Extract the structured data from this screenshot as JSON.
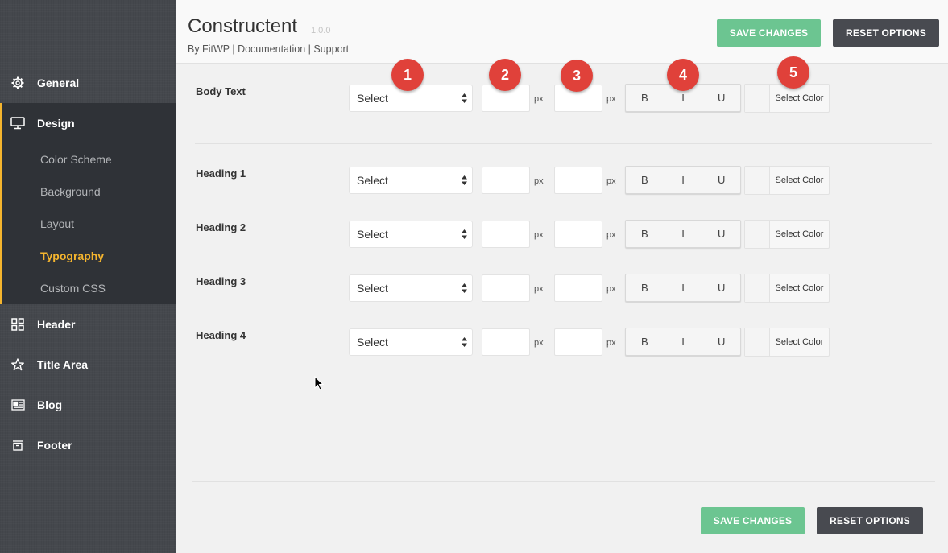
{
  "sidebar": {
    "items": [
      {
        "label": "General",
        "icon": "gear-icon"
      },
      {
        "label": "Design",
        "icon": "monitor-icon"
      },
      {
        "label": "Header",
        "icon": "grid-icon"
      },
      {
        "label": "Title Area",
        "icon": "star-icon"
      },
      {
        "label": "Blog",
        "icon": "newspaper-icon"
      },
      {
        "label": "Footer",
        "icon": "archive-icon"
      }
    ],
    "design_subitems": [
      "Color Scheme",
      "Background",
      "Layout",
      "Typography",
      "Custom CSS"
    ],
    "active_subitem": "Typography"
  },
  "header": {
    "title": "Constructent",
    "version": "1.0.0",
    "by": "By FitWP",
    "sep": "|",
    "documentation": "Documentation",
    "support": "Support",
    "save_label": "SAVE CHANGES",
    "reset_label": "RESET OPTIONS"
  },
  "rows": [
    {
      "label": "Body Text"
    },
    {
      "label": "Heading 1"
    },
    {
      "label": "Heading 2"
    },
    {
      "label": "Heading 3"
    },
    {
      "label": "Heading 4"
    }
  ],
  "controls": {
    "select_value": "Select",
    "unit": "px",
    "bold": "B",
    "italic": "I",
    "underline": "U",
    "color_label": "Select Color"
  },
  "badges": [
    "1",
    "2",
    "3",
    "4",
    "5"
  ],
  "footer": {
    "save_label": "SAVE CHANGES",
    "reset_label": "RESET OPTIONS"
  },
  "colors": {
    "accent": "#f5b52e",
    "save": "#6cc591",
    "reset": "#484a50",
    "badge": "#e0413a"
  }
}
